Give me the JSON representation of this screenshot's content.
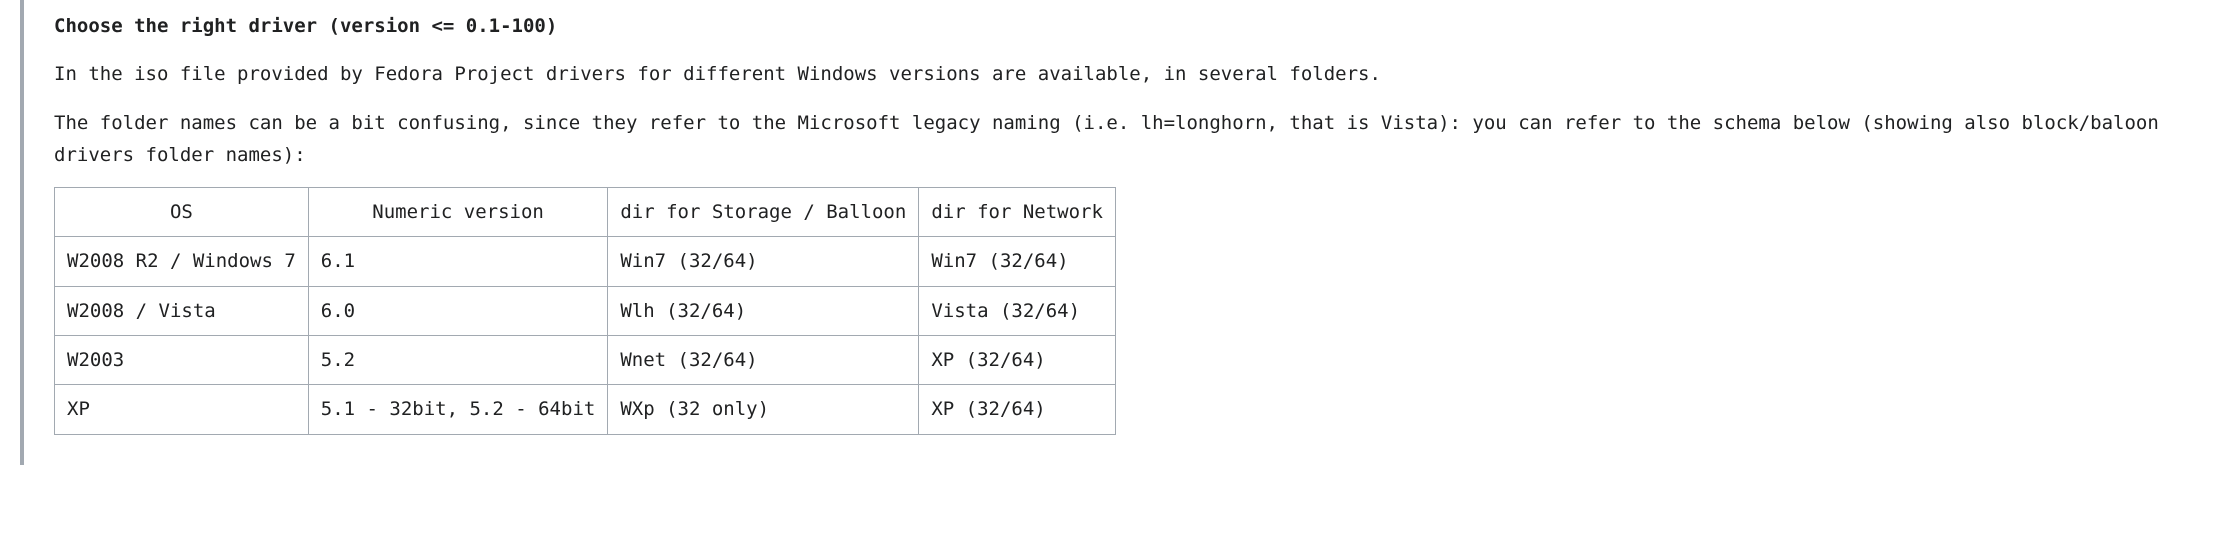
{
  "heading": "Choose the right driver (version <= 0.1-100)",
  "paragraphs": {
    "p1": "In the iso file provided by Fedora Project drivers for different Windows versions are available, in several folders.",
    "p2": "The folder names can be a bit confusing, since they refer to the Microsoft legacy naming (i.e. lh=longhorn, that is Vista): you can refer to the schema below (showing also block/baloon drivers folder names):"
  },
  "table": {
    "headers": {
      "h1": "OS",
      "h2": "Numeric version",
      "h3": "dir for Storage / Balloon",
      "h4": "dir for Network"
    },
    "rows": [
      {
        "c1": "W2008 R2 / Windows 7",
        "c2": "6.1",
        "c3": "Win7 (32/64)",
        "c4": "Win7 (32/64)"
      },
      {
        "c1": "W2008 / Vista",
        "c2": "6.0",
        "c3": "Wlh (32/64)",
        "c4": "Vista (32/64)"
      },
      {
        "c1": "W2003",
        "c2": "5.2",
        "c3": "Wnet (32/64)",
        "c4": "XP (32/64)"
      },
      {
        "c1": "XP",
        "c2": "5.1 - 32bit, 5.2 - 64bit",
        "c3": "WXp (32 only)",
        "c4": "XP (32/64)"
      }
    ]
  }
}
